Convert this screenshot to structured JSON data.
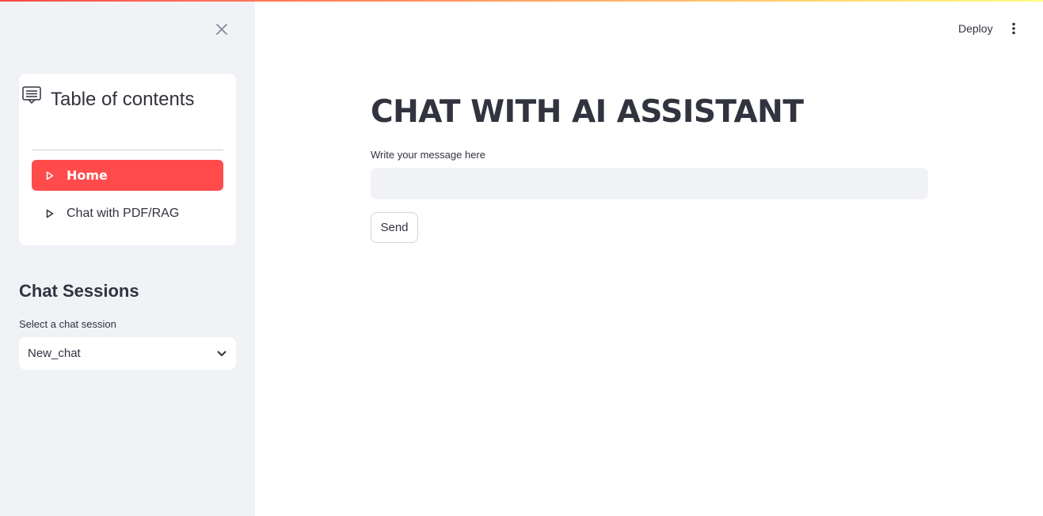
{
  "theme": {
    "primary": "#ff4b4b",
    "sidebar_bg": "#f0f2f6",
    "text": "#31333f"
  },
  "sidebar": {
    "close_icon": "close-icon",
    "toc": {
      "icon": "menu-lines-icon",
      "title": "Table of contents",
      "items": [
        {
          "label": "Home",
          "icon": "play-triangle-icon",
          "active": true
        },
        {
          "label": "Chat with PDF/RAG",
          "icon": "play-triangle-icon",
          "active": false
        }
      ]
    },
    "sessions": {
      "heading": "Chat Sessions",
      "select_label": "Select a chat session",
      "selected": "New_chat"
    }
  },
  "header": {
    "deploy_label": "Deploy",
    "menu_icon": "kebab-menu-icon"
  },
  "main": {
    "title": "CHAT WITH AI ASSISTANT",
    "input_label": "Write your message here",
    "input_value": "",
    "send_label": "Send"
  }
}
